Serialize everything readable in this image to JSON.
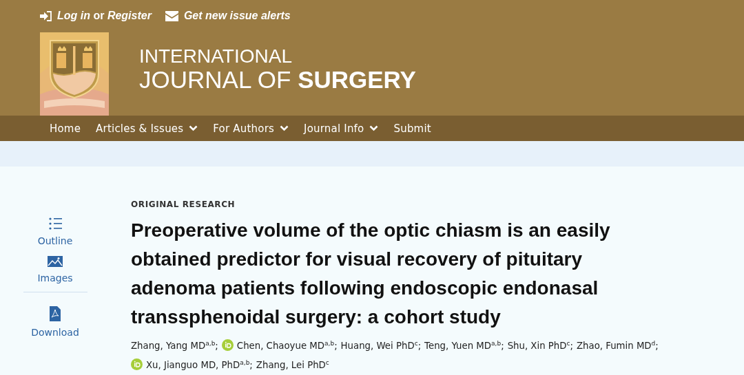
{
  "top_links": [
    {
      "kind": "login",
      "text": "*Log in* or *Register*"
    },
    {
      "kind": "alerts",
      "text": "Get new issue alerts"
    }
  ],
  "journal": {
    "line_1": "INTERNATIONAL",
    "line_2": "JOURNAL OF **SURGERY**"
  },
  "nav": [
    {
      "label": "Home",
      "dropdown": false
    },
    {
      "label": "Articles & Issues",
      "dropdown": true
    },
    {
      "label": "For Authors",
      "dropdown": true
    },
    {
      "label": "Journal Info",
      "dropdown": true
    },
    {
      "label": "Submit",
      "dropdown": false
    }
  ],
  "sidebar": [
    {
      "kind": "outline",
      "label": "Outline"
    },
    {
      "kind": "images",
      "label": "Images"
    },
    {
      "kind": "download",
      "label": "Download"
    }
  ],
  "article": {
    "type": "ORIGINAL RESEARCH",
    "title": "Preoperative volume of the optic chiasm is an easily obtained predictor for visual recovery of pituitary adenoma patients following endoscopic endonasal transsphenoidal surgery: a cohort study",
    "authors": [
      {
        "name": "Zhang, Yang MD$^{a,b}$;",
        "orcid": false
      },
      {
        "name": "Chen, Chaoyue MD$^{a,b}$;",
        "orcid": true
      },
      {
        "name": "Huang, Wei PhD$^{c}$;",
        "orcid": false
      },
      {
        "name": "Teng, Yuen MD$^{a,b}$;",
        "orcid": false
      },
      {
        "name": "Shu, Xin PhD$^{c}$;",
        "orcid": false
      },
      {
        "name": "Zhao, Fumin MD$^{d}$;",
        "orcid": false
      },
      {
        "name": "Xu, Jianguo MD, PhD$^{a,b}$;",
        "orcid": true
      },
      {
        "name": "Zhang, Lei PhD$^{c}$",
        "orcid": false
      }
    ]
  }
}
